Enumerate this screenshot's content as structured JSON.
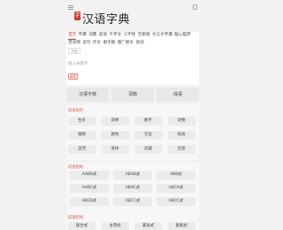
{
  "header": {
    "logo_mark": "字",
    "title": "汉语字典"
  },
  "search": {
    "tabs": [
      "首页",
      "字典",
      "词典",
      "成语",
      "千字文",
      "三字经",
      "百家姓",
      "文言文字典",
      "脑心脑梦",
      "范文网",
      "造句",
      "作文",
      "谢子报",
      "唐广君文",
      "诗词"
    ],
    "active_tab": 0,
    "input_tag": "字板",
    "placeholder": "输入关键字",
    "button": "搜索"
  },
  "nav": [
    "汉语字典",
    "词典",
    "成语"
  ],
  "sections": [
    {
      "title": "成语组合",
      "items": [
        "生肖",
        "四季",
        "数字",
        "动物",
        "植物",
        "颜色",
        "方位",
        "味道",
        "自然",
        "身体",
        "武器",
        "全部"
      ]
    },
    {
      "title": "成语结构",
      "items": [
        "AABB式",
        "ABAB式",
        "ABB式",
        "AABC式",
        "ABAC式",
        "ABCA式",
        "ABCB式",
        "ABCC式",
        "ABCC式"
      ]
    },
    {
      "title": "成语结构",
      "items": [
        "联合式",
        "主谓式",
        "兼语式",
        "紧缩式"
      ]
    }
  ]
}
